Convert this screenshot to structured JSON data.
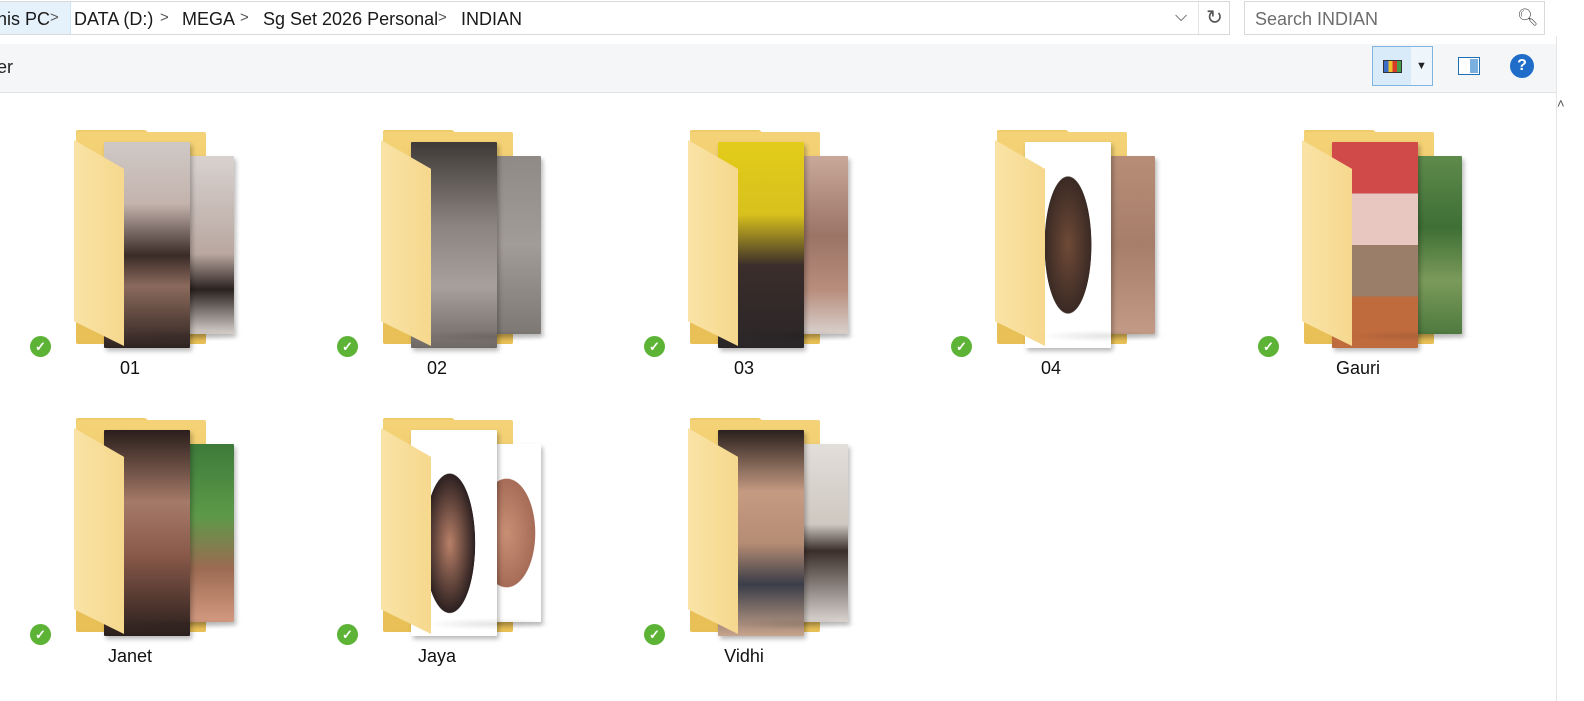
{
  "breadcrumb": {
    "items": [
      "his PC",
      "DATA (D:)",
      "MEGA",
      "Sg Set 2026 Personal",
      "INDIAN"
    ],
    "separator": ">"
  },
  "address": {
    "dropdown_icon": "chevron-down-icon",
    "refresh_icon": "refresh-icon"
  },
  "search": {
    "placeholder": "Search INDIAN",
    "icon": "magnifier-icon"
  },
  "toolbar": {
    "partial_label": "er",
    "view_icon": "large-icons-view-icon",
    "pane_icon": "preview-pane-icon",
    "help_icon": "help-icon",
    "help_symbol": "?"
  },
  "status_symbol": "✓",
  "colors": {
    "folder": "#f4d277",
    "sync_ok": "#5cb336",
    "help": "#1f6cc9",
    "selection": "#d9ebf9"
  },
  "folders": [
    {
      "name": "01",
      "status": "synced"
    },
    {
      "name": "02",
      "status": "synced"
    },
    {
      "name": "03",
      "status": "synced"
    },
    {
      "name": "04",
      "status": "synced"
    },
    {
      "name": "Gauri",
      "status": "synced"
    },
    {
      "name": "Janet",
      "status": "synced"
    },
    {
      "name": "Jaya",
      "status": "synced"
    },
    {
      "name": "Vidhi",
      "status": "synced"
    }
  ]
}
